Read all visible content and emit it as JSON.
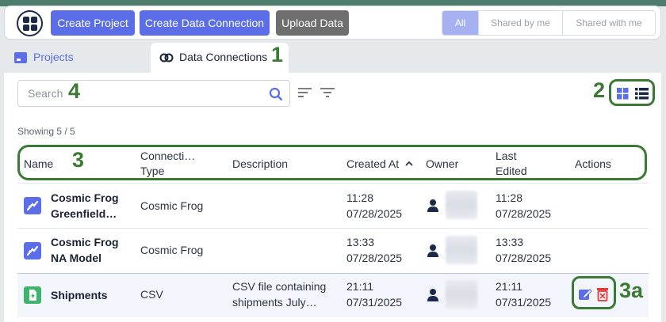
{
  "toolbar": {
    "create_project": "Create Project",
    "create_data_connection": "Create Data Connection",
    "upload_data": "Upload Data",
    "filters": [
      "All",
      "Shared by me",
      "Shared with me"
    ]
  },
  "tabs": [
    {
      "label": "Projects"
    },
    {
      "label": "Data Connections"
    }
  ],
  "search": {
    "placeholder": "Search"
  },
  "showing": "Showing 5 / 5",
  "annotations": {
    "n1": "1",
    "n2": "2",
    "n3": "3",
    "n3a": "3a",
    "n4": "4"
  },
  "table": {
    "columns": {
      "name": "Name",
      "type_l1": "Connecti…",
      "type_l2": "Type",
      "description": "Description",
      "created": "Created At",
      "owner": "Owner",
      "edited_l1": "Last",
      "edited_l2": "Edited",
      "actions": "Actions"
    },
    "rows": [
      {
        "name_l1": "Cosmic Frog",
        "name_l2": "Greenfield…",
        "type": "Cosmic Frog",
        "desc_l1": "",
        "desc_l2": "",
        "created_time": "11:28",
        "created_date": "07/28/2025",
        "edited_time": "11:28",
        "edited_date": "07/28/2025"
      },
      {
        "name_l1": "Cosmic Frog",
        "name_l2": "NA Model",
        "type": "Cosmic Frog",
        "desc_l1": "",
        "desc_l2": "",
        "created_time": "13:33",
        "created_date": "07/28/2025",
        "edited_time": "13:33",
        "edited_date": "07/28/2025"
      },
      {
        "name_l1": "Shipments",
        "name_l2": "",
        "type": "CSV",
        "desc_l1": "CSV file containing",
        "desc_l2": "shipments July…",
        "created_time": "21:11",
        "created_date": "07/31/2025",
        "edited_time": "21:11",
        "edited_date": "07/31/2025"
      }
    ]
  },
  "colors": {
    "accent": "#5b6ee8",
    "annotation": "#3b7a32",
    "frog_icon": "#5b6ee8",
    "csv_icon": "#3fb56b",
    "delete": "#e53935"
  }
}
